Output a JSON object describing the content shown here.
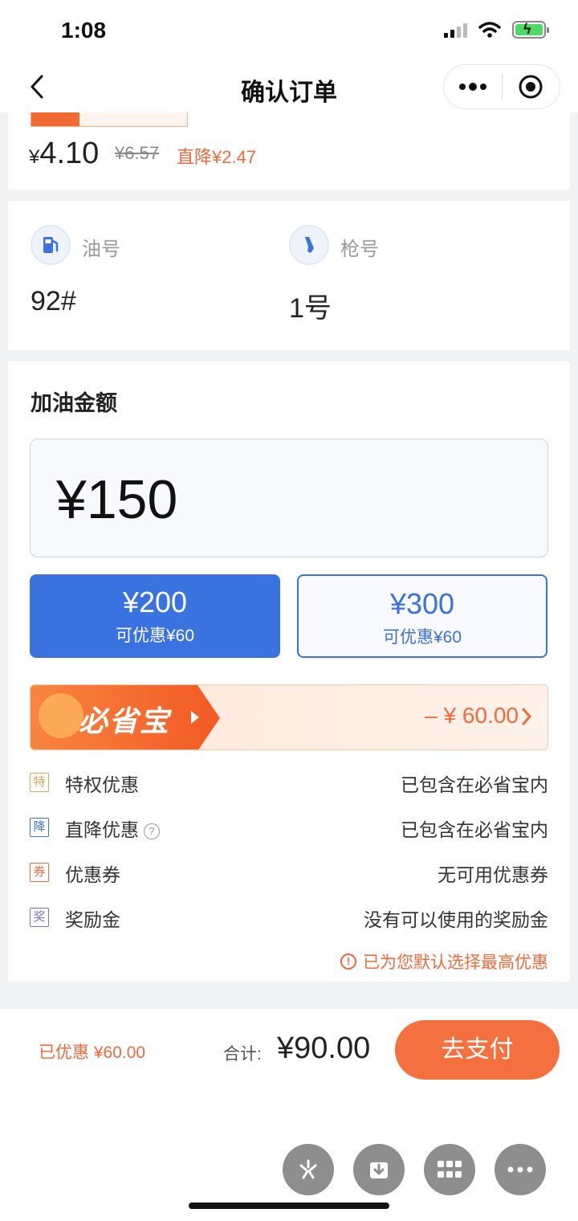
{
  "status_bar": {
    "time": "1:08"
  },
  "nav": {
    "title": "确认订单"
  },
  "price": {
    "yen": "¥",
    "current": "4.10",
    "original": "¥6.57",
    "drop": "直降¥2.47"
  },
  "fuel": {
    "oil_label": "油号",
    "oil_value": "92#",
    "gun_label": "枪号",
    "gun_value": "1号"
  },
  "amount": {
    "section_title": "加油金额",
    "input_value": "¥150",
    "options": [
      {
        "amount": "¥200",
        "discount": "可优惠¥60",
        "selected": true
      },
      {
        "amount": "¥300",
        "discount": "可优惠¥60",
        "selected": false
      }
    ]
  },
  "saver": {
    "name": "必省宝",
    "amount": "– ¥ 60.00"
  },
  "discounts": [
    {
      "badge": "特",
      "label": "特权优惠",
      "value": "已包含在必省宝内",
      "color": "#e8a25a"
    },
    {
      "badge": "降",
      "label": "直降优惠",
      "value": "已包含在必省宝内",
      "color": "#3a72e0",
      "help": "?"
    },
    {
      "badge": "券",
      "label": "优惠券",
      "value": "无可用优惠券",
      "color": "#f26a3b"
    },
    {
      "badge": "奖",
      "label": "奖励金",
      "value": "没有可以使用的奖励金",
      "color": "#7b6fd6"
    }
  ],
  "tip": {
    "icon": "!",
    "text": "已为您默认选择最高优惠"
  },
  "footer": {
    "saved": "已优惠 ¥60.00",
    "total_label": "合计:",
    "total_value": "¥90.00",
    "pay_button": "去支付"
  },
  "colors": {
    "accent_blue": "#3a72e0",
    "accent_orange": "#f26a3b",
    "pay_button": "#f4713f"
  },
  "icons": [
    "back-arrow-icon",
    "more-dots-icon",
    "target-icon",
    "fuel-pump-icon",
    "fuel-nozzle-icon",
    "help-icon",
    "chevron-right-icon",
    "sparkle-icon",
    "download-icon",
    "grid-icon",
    "more-icon"
  ]
}
